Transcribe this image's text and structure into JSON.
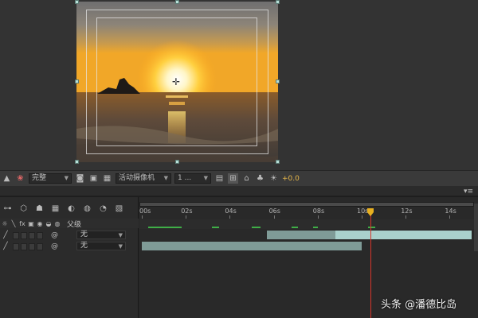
{
  "viewer_toolbar": {
    "magnification": "完整",
    "camera": "活动摄像机",
    "views": "1 ...",
    "exposure": "+0.0"
  },
  "timeline": {
    "parent_column": "父级",
    "time_labels": [
      "00s",
      "02s",
      "04s",
      "06s",
      "08s",
      "10s",
      "12s",
      "14s"
    ],
    "playhead_seconds": 10.4,
    "duration_seconds": 15,
    "layers": [
      {
        "parent": "无",
        "bar_start_s": 5.7,
        "bar_end_s": 15,
        "selected_start_s": 8.8
      },
      {
        "parent": "无",
        "bar_start_s": 0,
        "bar_end_s": 10.0
      }
    ]
  },
  "colors": {
    "playhead": "#d7352b",
    "layer_bar": "#7f9b97",
    "layer_bar_selected": "#a9d1cc",
    "cache": "#3fae47"
  },
  "icons": [
    "camera-icon",
    "color-icon",
    "region-icon",
    "grid-icon",
    "snapshot-icon",
    "3d-view-icon",
    "fast-preview-icon",
    "graph-editor-icon",
    "motion-blur-icon"
  ],
  "watermark": "头条 @潘德比岛"
}
